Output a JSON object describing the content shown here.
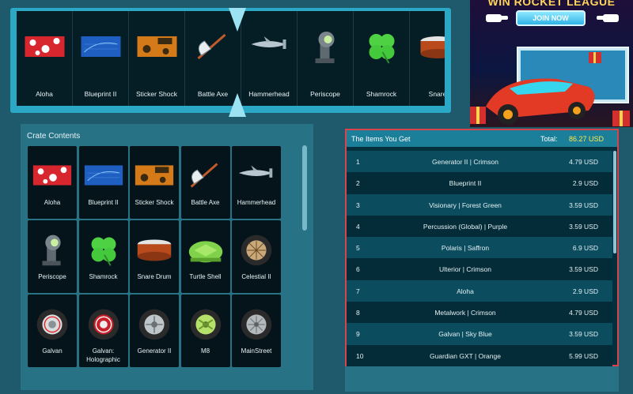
{
  "reel": {
    "items": [
      {
        "label": "Aloha",
        "icon": "aloha-decal-icon"
      },
      {
        "label": "Blueprint II",
        "icon": "blueprint-decal-icon"
      },
      {
        "label": "Sticker Shock",
        "icon": "sticker-shock-decal-icon"
      },
      {
        "label": "Battle Axe",
        "icon": "battle-axe-icon"
      },
      {
        "label": "Hammerhead",
        "icon": "hammerhead-shark-icon"
      },
      {
        "label": "Periscope",
        "icon": "periscope-icon"
      },
      {
        "label": "Shamrock",
        "icon": "shamrock-icon"
      },
      {
        "label": "Snare",
        "icon": "snare-drum-icon"
      }
    ]
  },
  "ad": {
    "title": "WIN ROCKET LEAGUE ITEMS",
    "cta": "JOIN NOW"
  },
  "crate": {
    "title": "Crate Contents",
    "items": [
      {
        "label": "Aloha",
        "icon": "aloha-decal-icon"
      },
      {
        "label": "Blueprint II",
        "icon": "blueprint-decal-icon"
      },
      {
        "label": "Sticker Shock",
        "icon": "sticker-shock-decal-icon"
      },
      {
        "label": "Battle Axe",
        "icon": "battle-axe-icon"
      },
      {
        "label": "Hammerhead",
        "icon": "hammerhead-shark-icon"
      },
      {
        "label": "Periscope",
        "icon": "periscope-icon"
      },
      {
        "label": "Shamrock",
        "icon": "shamrock-icon"
      },
      {
        "label": "Snare Drum",
        "icon": "snare-drum-icon"
      },
      {
        "label": "Turtle Shell",
        "icon": "turtle-shell-icon"
      },
      {
        "label": "Celestial II",
        "icon": "celestial-wheel-icon"
      },
      {
        "label": "Galvan",
        "icon": "galvan-wheel-icon"
      },
      {
        "label": "Galvan: Holographic",
        "icon": "galvan-holographic-wheel-icon"
      },
      {
        "label": "Generator II",
        "icon": "generator-wheel-icon"
      },
      {
        "label": "M8",
        "icon": "m8-wheel-icon"
      },
      {
        "label": "MainStreet",
        "icon": "mainstreet-wheel-icon"
      }
    ]
  },
  "items_you_get": {
    "title": "The Items You Get",
    "total_label": "Total:",
    "total_value": "86.27 USD",
    "rows": [
      {
        "n": "1",
        "name": "Generator II | Crimson",
        "price": "4.79 USD"
      },
      {
        "n": "2",
        "name": "Blueprint II",
        "price": "2.9 USD"
      },
      {
        "n": "3",
        "name": "Visionary | Forest Green",
        "price": "3.59 USD"
      },
      {
        "n": "4",
        "name": "Percussion (Global) | Purple",
        "price": "3.59 USD"
      },
      {
        "n": "5",
        "name": "Polaris | Saffron",
        "price": "6.9 USD"
      },
      {
        "n": "6",
        "name": "Ulterior | Crimson",
        "price": "3.59 USD"
      },
      {
        "n": "7",
        "name": "Aloha",
        "price": "2.9 USD"
      },
      {
        "n": "8",
        "name": "Metalwork | Crimson",
        "price": "4.79 USD"
      },
      {
        "n": "9",
        "name": "Galvan | Sky Blue",
        "price": "3.59 USD"
      },
      {
        "n": "10",
        "name": "Guardian GXT | Orange",
        "price": "5.99 USD"
      }
    ]
  },
  "colors": {
    "background": "#1f5a6c",
    "panel": "#287286",
    "reel_frame": "#2aa8c6",
    "highlight_border": "#d9434c",
    "total_value": "#ffe84d"
  }
}
